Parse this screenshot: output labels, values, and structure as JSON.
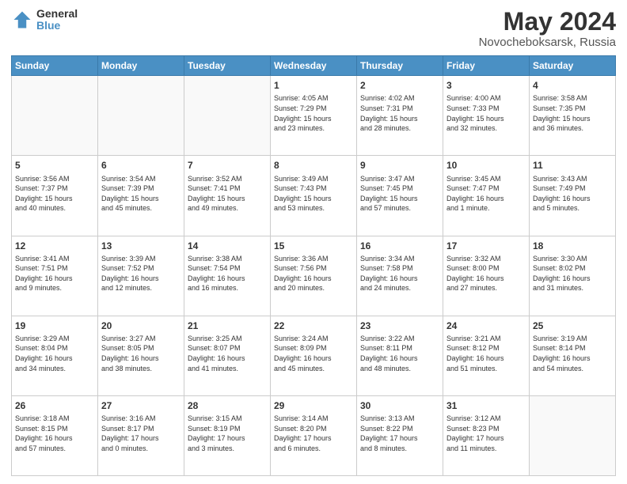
{
  "logo": {
    "general": "General",
    "blue": "Blue"
  },
  "title": {
    "month_year": "May 2024",
    "location": "Novocheboksarsk, Russia"
  },
  "weekdays": [
    "Sunday",
    "Monday",
    "Tuesday",
    "Wednesday",
    "Thursday",
    "Friday",
    "Saturday"
  ],
  "weeks": [
    [
      {
        "day": "",
        "info": ""
      },
      {
        "day": "",
        "info": ""
      },
      {
        "day": "",
        "info": ""
      },
      {
        "day": "1",
        "info": "Sunrise: 4:05 AM\nSunset: 7:29 PM\nDaylight: 15 hours\nand 23 minutes."
      },
      {
        "day": "2",
        "info": "Sunrise: 4:02 AM\nSunset: 7:31 PM\nDaylight: 15 hours\nand 28 minutes."
      },
      {
        "day": "3",
        "info": "Sunrise: 4:00 AM\nSunset: 7:33 PM\nDaylight: 15 hours\nand 32 minutes."
      },
      {
        "day": "4",
        "info": "Sunrise: 3:58 AM\nSunset: 7:35 PM\nDaylight: 15 hours\nand 36 minutes."
      }
    ],
    [
      {
        "day": "5",
        "info": "Sunrise: 3:56 AM\nSunset: 7:37 PM\nDaylight: 15 hours\nand 40 minutes."
      },
      {
        "day": "6",
        "info": "Sunrise: 3:54 AM\nSunset: 7:39 PM\nDaylight: 15 hours\nand 45 minutes."
      },
      {
        "day": "7",
        "info": "Sunrise: 3:52 AM\nSunset: 7:41 PM\nDaylight: 15 hours\nand 49 minutes."
      },
      {
        "day": "8",
        "info": "Sunrise: 3:49 AM\nSunset: 7:43 PM\nDaylight: 15 hours\nand 53 minutes."
      },
      {
        "day": "9",
        "info": "Sunrise: 3:47 AM\nSunset: 7:45 PM\nDaylight: 15 hours\nand 57 minutes."
      },
      {
        "day": "10",
        "info": "Sunrise: 3:45 AM\nSunset: 7:47 PM\nDaylight: 16 hours\nand 1 minute."
      },
      {
        "day": "11",
        "info": "Sunrise: 3:43 AM\nSunset: 7:49 PM\nDaylight: 16 hours\nand 5 minutes."
      }
    ],
    [
      {
        "day": "12",
        "info": "Sunrise: 3:41 AM\nSunset: 7:51 PM\nDaylight: 16 hours\nand 9 minutes."
      },
      {
        "day": "13",
        "info": "Sunrise: 3:39 AM\nSunset: 7:52 PM\nDaylight: 16 hours\nand 12 minutes."
      },
      {
        "day": "14",
        "info": "Sunrise: 3:38 AM\nSunset: 7:54 PM\nDaylight: 16 hours\nand 16 minutes."
      },
      {
        "day": "15",
        "info": "Sunrise: 3:36 AM\nSunset: 7:56 PM\nDaylight: 16 hours\nand 20 minutes."
      },
      {
        "day": "16",
        "info": "Sunrise: 3:34 AM\nSunset: 7:58 PM\nDaylight: 16 hours\nand 24 minutes."
      },
      {
        "day": "17",
        "info": "Sunrise: 3:32 AM\nSunset: 8:00 PM\nDaylight: 16 hours\nand 27 minutes."
      },
      {
        "day": "18",
        "info": "Sunrise: 3:30 AM\nSunset: 8:02 PM\nDaylight: 16 hours\nand 31 minutes."
      }
    ],
    [
      {
        "day": "19",
        "info": "Sunrise: 3:29 AM\nSunset: 8:04 PM\nDaylight: 16 hours\nand 34 minutes."
      },
      {
        "day": "20",
        "info": "Sunrise: 3:27 AM\nSunset: 8:05 PM\nDaylight: 16 hours\nand 38 minutes."
      },
      {
        "day": "21",
        "info": "Sunrise: 3:25 AM\nSunset: 8:07 PM\nDaylight: 16 hours\nand 41 minutes."
      },
      {
        "day": "22",
        "info": "Sunrise: 3:24 AM\nSunset: 8:09 PM\nDaylight: 16 hours\nand 45 minutes."
      },
      {
        "day": "23",
        "info": "Sunrise: 3:22 AM\nSunset: 8:11 PM\nDaylight: 16 hours\nand 48 minutes."
      },
      {
        "day": "24",
        "info": "Sunrise: 3:21 AM\nSunset: 8:12 PM\nDaylight: 16 hours\nand 51 minutes."
      },
      {
        "day": "25",
        "info": "Sunrise: 3:19 AM\nSunset: 8:14 PM\nDaylight: 16 hours\nand 54 minutes."
      }
    ],
    [
      {
        "day": "26",
        "info": "Sunrise: 3:18 AM\nSunset: 8:15 PM\nDaylight: 16 hours\nand 57 minutes."
      },
      {
        "day": "27",
        "info": "Sunrise: 3:16 AM\nSunset: 8:17 PM\nDaylight: 17 hours\nand 0 minutes."
      },
      {
        "day": "28",
        "info": "Sunrise: 3:15 AM\nSunset: 8:19 PM\nDaylight: 17 hours\nand 3 minutes."
      },
      {
        "day": "29",
        "info": "Sunrise: 3:14 AM\nSunset: 8:20 PM\nDaylight: 17 hours\nand 6 minutes."
      },
      {
        "day": "30",
        "info": "Sunrise: 3:13 AM\nSunset: 8:22 PM\nDaylight: 17 hours\nand 8 minutes."
      },
      {
        "day": "31",
        "info": "Sunrise: 3:12 AM\nSunset: 8:23 PM\nDaylight: 17 hours\nand 11 minutes."
      },
      {
        "day": "",
        "info": ""
      }
    ]
  ]
}
